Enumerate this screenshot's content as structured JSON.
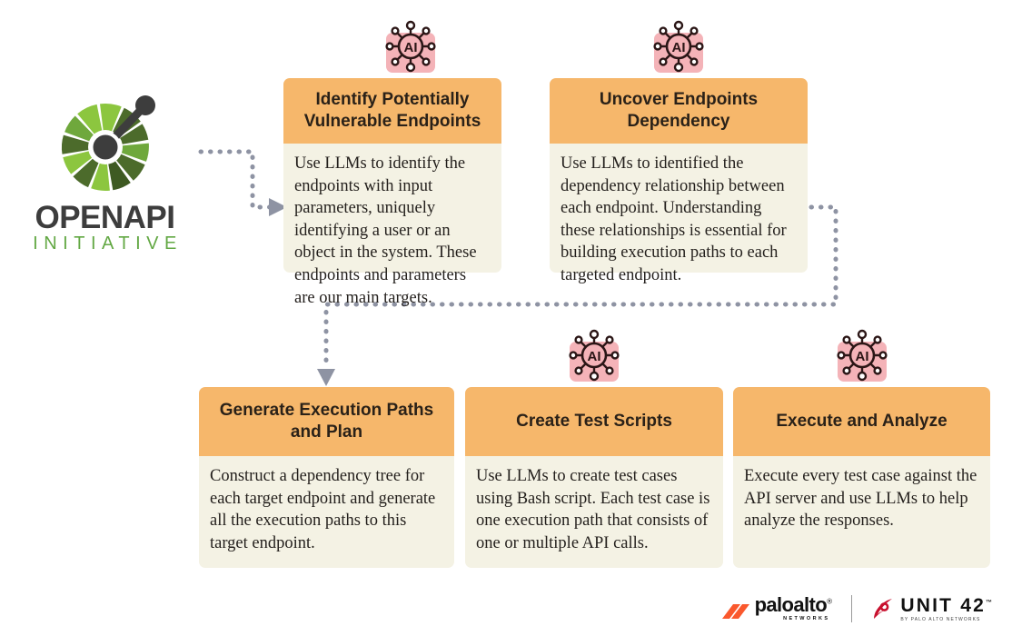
{
  "logo": {
    "name": "OPENAPI",
    "subtitle": "INITIATIVE",
    "mark_alt": "openapi-wheel-mark"
  },
  "colors": {
    "header_orange": "#F6B76B",
    "body_cream": "#F4F2E4",
    "icon_pink": "#F4B3B8",
    "icon_outline": "#2B1616",
    "connector_gray": "#8E93A3",
    "logo_green": "#63A844",
    "logo_dark_green": "#4C6B2B",
    "logo_gray": "#3D3D3D",
    "paloalto_orange": "#FA582D",
    "unit42_red": "#C8102E"
  },
  "icon": {
    "label": "AI",
    "name": "ai-node-icon"
  },
  "cards": [
    {
      "id": "identify-potentially-vulnerable-endpoints",
      "title": "Identify Potentially Vulnerable Endpoints",
      "body": "Use LLMs to identify the endpoints with input parameters, uniquely identifying a user or an object in the system. These endpoints and parameters are our main targets.",
      "has_ai_icon": true
    },
    {
      "id": "uncover-endpoints-dependency",
      "title": "Uncover Endpoints Dependency",
      "body": "Use LLMs to identified the dependency relationship between each endpoint. Understanding these relationships is essential for building execution paths to each targeted endpoint.",
      "has_ai_icon": true
    },
    {
      "id": "generate-execution-paths-and-plan",
      "title": "Generate Execution Paths and Plan",
      "body": "Construct a dependency tree for each target endpoint and generate all the execution paths to this target endpoint.",
      "has_ai_icon": false
    },
    {
      "id": "create-test-scripts",
      "title": "Create Test Scripts",
      "body": "Use LLMs to create test cases using Bash script. Each test case is one execution path that consists of one or multiple API calls.",
      "has_ai_icon": true
    },
    {
      "id": "execute-and-analyze",
      "title": "Execute and Analyze",
      "body": "Execute every test case against the API server and use LLMs to help analyze the responses.",
      "has_ai_icon": true
    }
  ],
  "footer": {
    "paloalto_name": "paloalto",
    "paloalto_registered": "®",
    "paloalto_sub": "NETWORKS",
    "unit42_name": "UNIT 42",
    "unit42_tm": "™",
    "unit42_sub": "BY PALO ALTO NETWORKS"
  }
}
